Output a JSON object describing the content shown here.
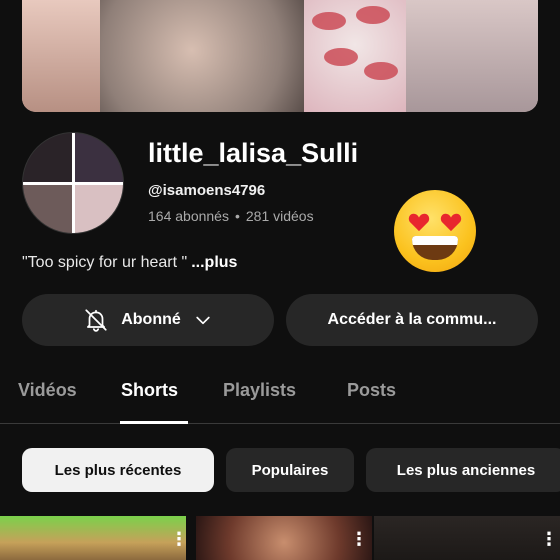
{
  "channel": {
    "name": "little_lalisa_Sulli",
    "handle": "@isamoens4796",
    "subscribers": "164 abonnés",
    "separator": "•",
    "videos": "281 vidéos",
    "description": "\"Too spicy for ur heart \"",
    "more_label": "...plus"
  },
  "actions": {
    "subscribed_label": "Abonné",
    "community_label": "Accéder à la commu..."
  },
  "tabs": [
    {
      "label": "Vidéos",
      "active": false
    },
    {
      "label": "Shorts",
      "active": true
    },
    {
      "label": "Playlists",
      "active": false
    },
    {
      "label": "Posts",
      "active": false
    }
  ],
  "filters": [
    {
      "label": "Les plus récentes",
      "active": true
    },
    {
      "label": "Populaires",
      "active": false
    },
    {
      "label": "Les plus anciennes",
      "active": false
    }
  ],
  "icons": {
    "bell": "bell-off-icon",
    "chevron": "chevron-down-icon",
    "menu": "more-vertical-icon",
    "emoji": "heart-eyes-emoji"
  },
  "colors": {
    "background": "#0f0f0f",
    "chip": "#272727",
    "chip_active": "#f1f1f1",
    "muted_text": "#aaaaaa"
  }
}
